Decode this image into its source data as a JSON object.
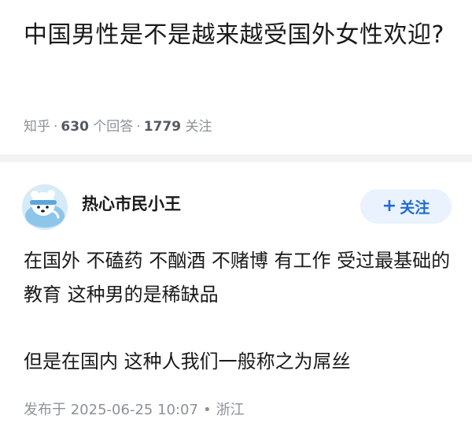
{
  "question": {
    "title": "中国男性是不是越来越受国外女性欢迎?",
    "source": "知乎",
    "answer_count": "630",
    "answer_label": "个回答",
    "follower_count": "1779",
    "follower_label": "关注"
  },
  "answer": {
    "author_name": "热心市民小王",
    "avatar_icon": "polar-bear-avatar-icon",
    "follow_label": "关注",
    "follow_icon": "plus-icon",
    "paragraphs": [
      "在国外 不磕药 不酗酒 不赌博 有工作 受过最基础的教育 这种男的是稀缺品",
      "但是在国内 这种人我们一般称之为屌丝"
    ],
    "published_prefix": "发布于",
    "published_time": "2025-06-25 10:07",
    "location": "浙江"
  },
  "colors": {
    "accent": "#1e6bd6",
    "follow_bg": "#eaf2fd",
    "meta_text": "#8d9199",
    "divider": "#f2f3f5"
  }
}
